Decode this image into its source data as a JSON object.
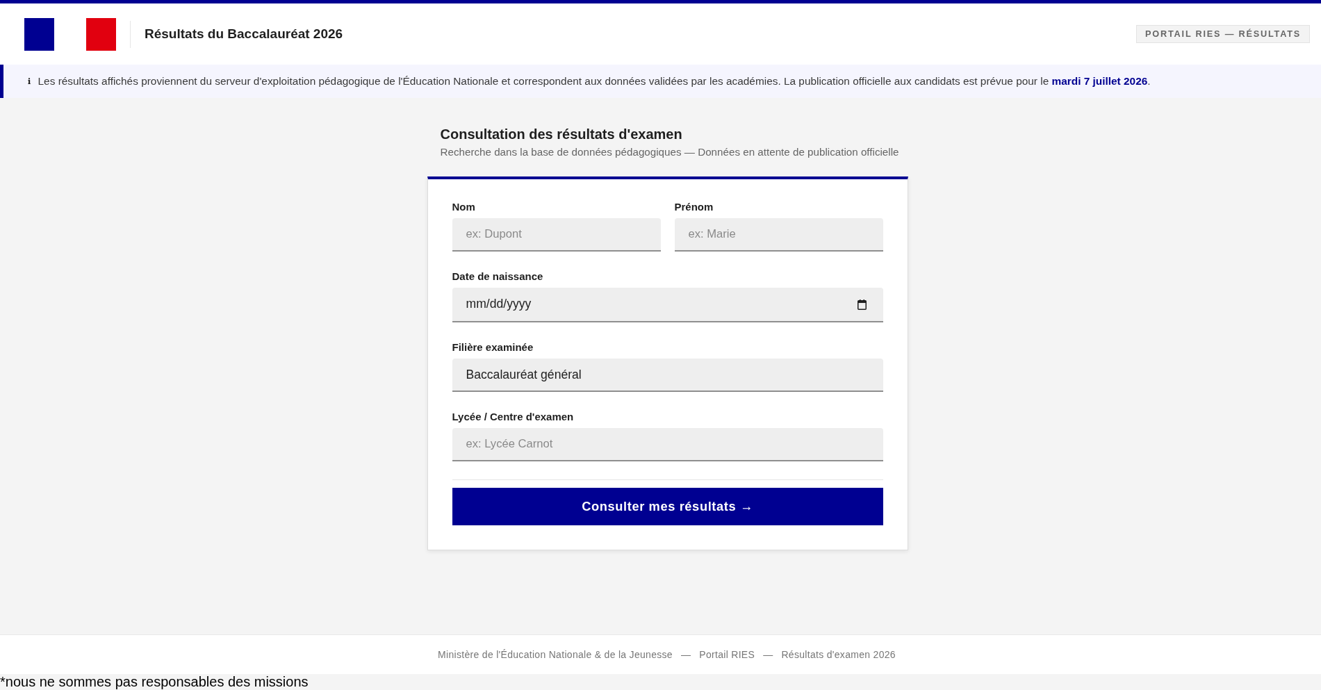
{
  "header": {
    "title": "Résultats du Baccalauréat 2026",
    "tag": "PORTAIL RIES — RÉSULTATS"
  },
  "notice": {
    "icon": "ℹ",
    "text": "Les résultats affichés proviennent du serveur d'exploitation pédagogique de l'Éducation Nationale et correspondent aux données validées par les académies. La publication officielle aux candidats est prévue pour le **mardi 7 juillet 2026**."
  },
  "form": {
    "title": "Consultation des résultats d'examen",
    "subtitle": "Recherche dans la base de données pédagogiques — Données en attente de publication officielle",
    "rows": [
      [
        {
          "kind": "text",
          "label": "Nom",
          "placeholder": "ex: Dupont"
        },
        {
          "kind": "text",
          "label": "Prénom",
          "placeholder": "ex: Marie"
        }
      ],
      [
        {
          "kind": "date",
          "label": "Date de naissance",
          "placeholder": "mm/dd/yyyy"
        }
      ],
      [
        {
          "kind": "select",
          "label": "Filière examinée",
          "value": "Baccalauréat général"
        }
      ],
      [
        {
          "kind": "text",
          "label": "Lycée / Centre d'examen",
          "placeholder": "ex: Lycée Carnot"
        }
      ]
    ],
    "submit": "Consulter mes résultats →"
  },
  "footer": {
    "parts": [
      "Ministère de l'Éducation Nationale & de la Jeunesse",
      "—",
      "Portail RIES",
      "—",
      "Résultats d'examen 2026"
    ]
  },
  "disclaimer": "*nous ne sommes pas responsables des missions"
}
